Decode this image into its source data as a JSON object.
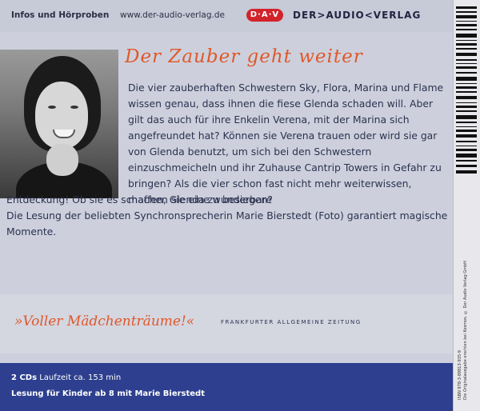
{
  "header": {
    "info_label": "Infos und Hörproben",
    "url": "www.der-audio-verlag.de",
    "badge": "D·A·V",
    "publisher": "DER>AUDIO<VERLAG"
  },
  "title": "Der Zauber geht weiter",
  "body": {
    "paragraph_narrow": "Die vier zauberhaften Schwestern Sky, Flora, Marina und Flame wissen genau, dass ihnen die fiese Glenda schaden will. Aber gilt das auch für ihre Enkelin Verena, mit der Marina sich angefreundet hat? Können sie Verena trauen oder wird sie gar von Glenda benutzt, um sich bei den Schwestern einzuschmeicheln und ihr Zuhause Cantrip Towers in Gefahr zu bringen? Als die vier schon fast nicht mehr weiterwissen, machen sie eine wunderbare",
    "paragraph_wide": "Entdeckung! Ob sie es schaffen, Glenda zu besiegen?",
    "paragraph_2": "Die Lesung der beliebten Synchronsprecherin Marie Bierstedt (Foto) garantiert magische Momente."
  },
  "quote": {
    "text": "»Voller Mädchenträume!«",
    "source": "FRANKFURTER ALLGEMEINE ZEITUNG"
  },
  "footer": {
    "line1_bold": "2 CDs",
    "line1_rest": " Laufzeit ca. 153 min",
    "line2": "Lesung für Kinder ab 8 mit Marie Bierstedt"
  },
  "spine": {
    "isbn_text": "ISBN 978-3-89813-935-9",
    "small_print": "Die Originalausgabe erschien bei Kosmos. © Der Audio Verlag GmbH"
  },
  "colors": {
    "accent": "#e0582a",
    "footer_bg": "#2d3f8e",
    "badge": "#d2232a"
  }
}
